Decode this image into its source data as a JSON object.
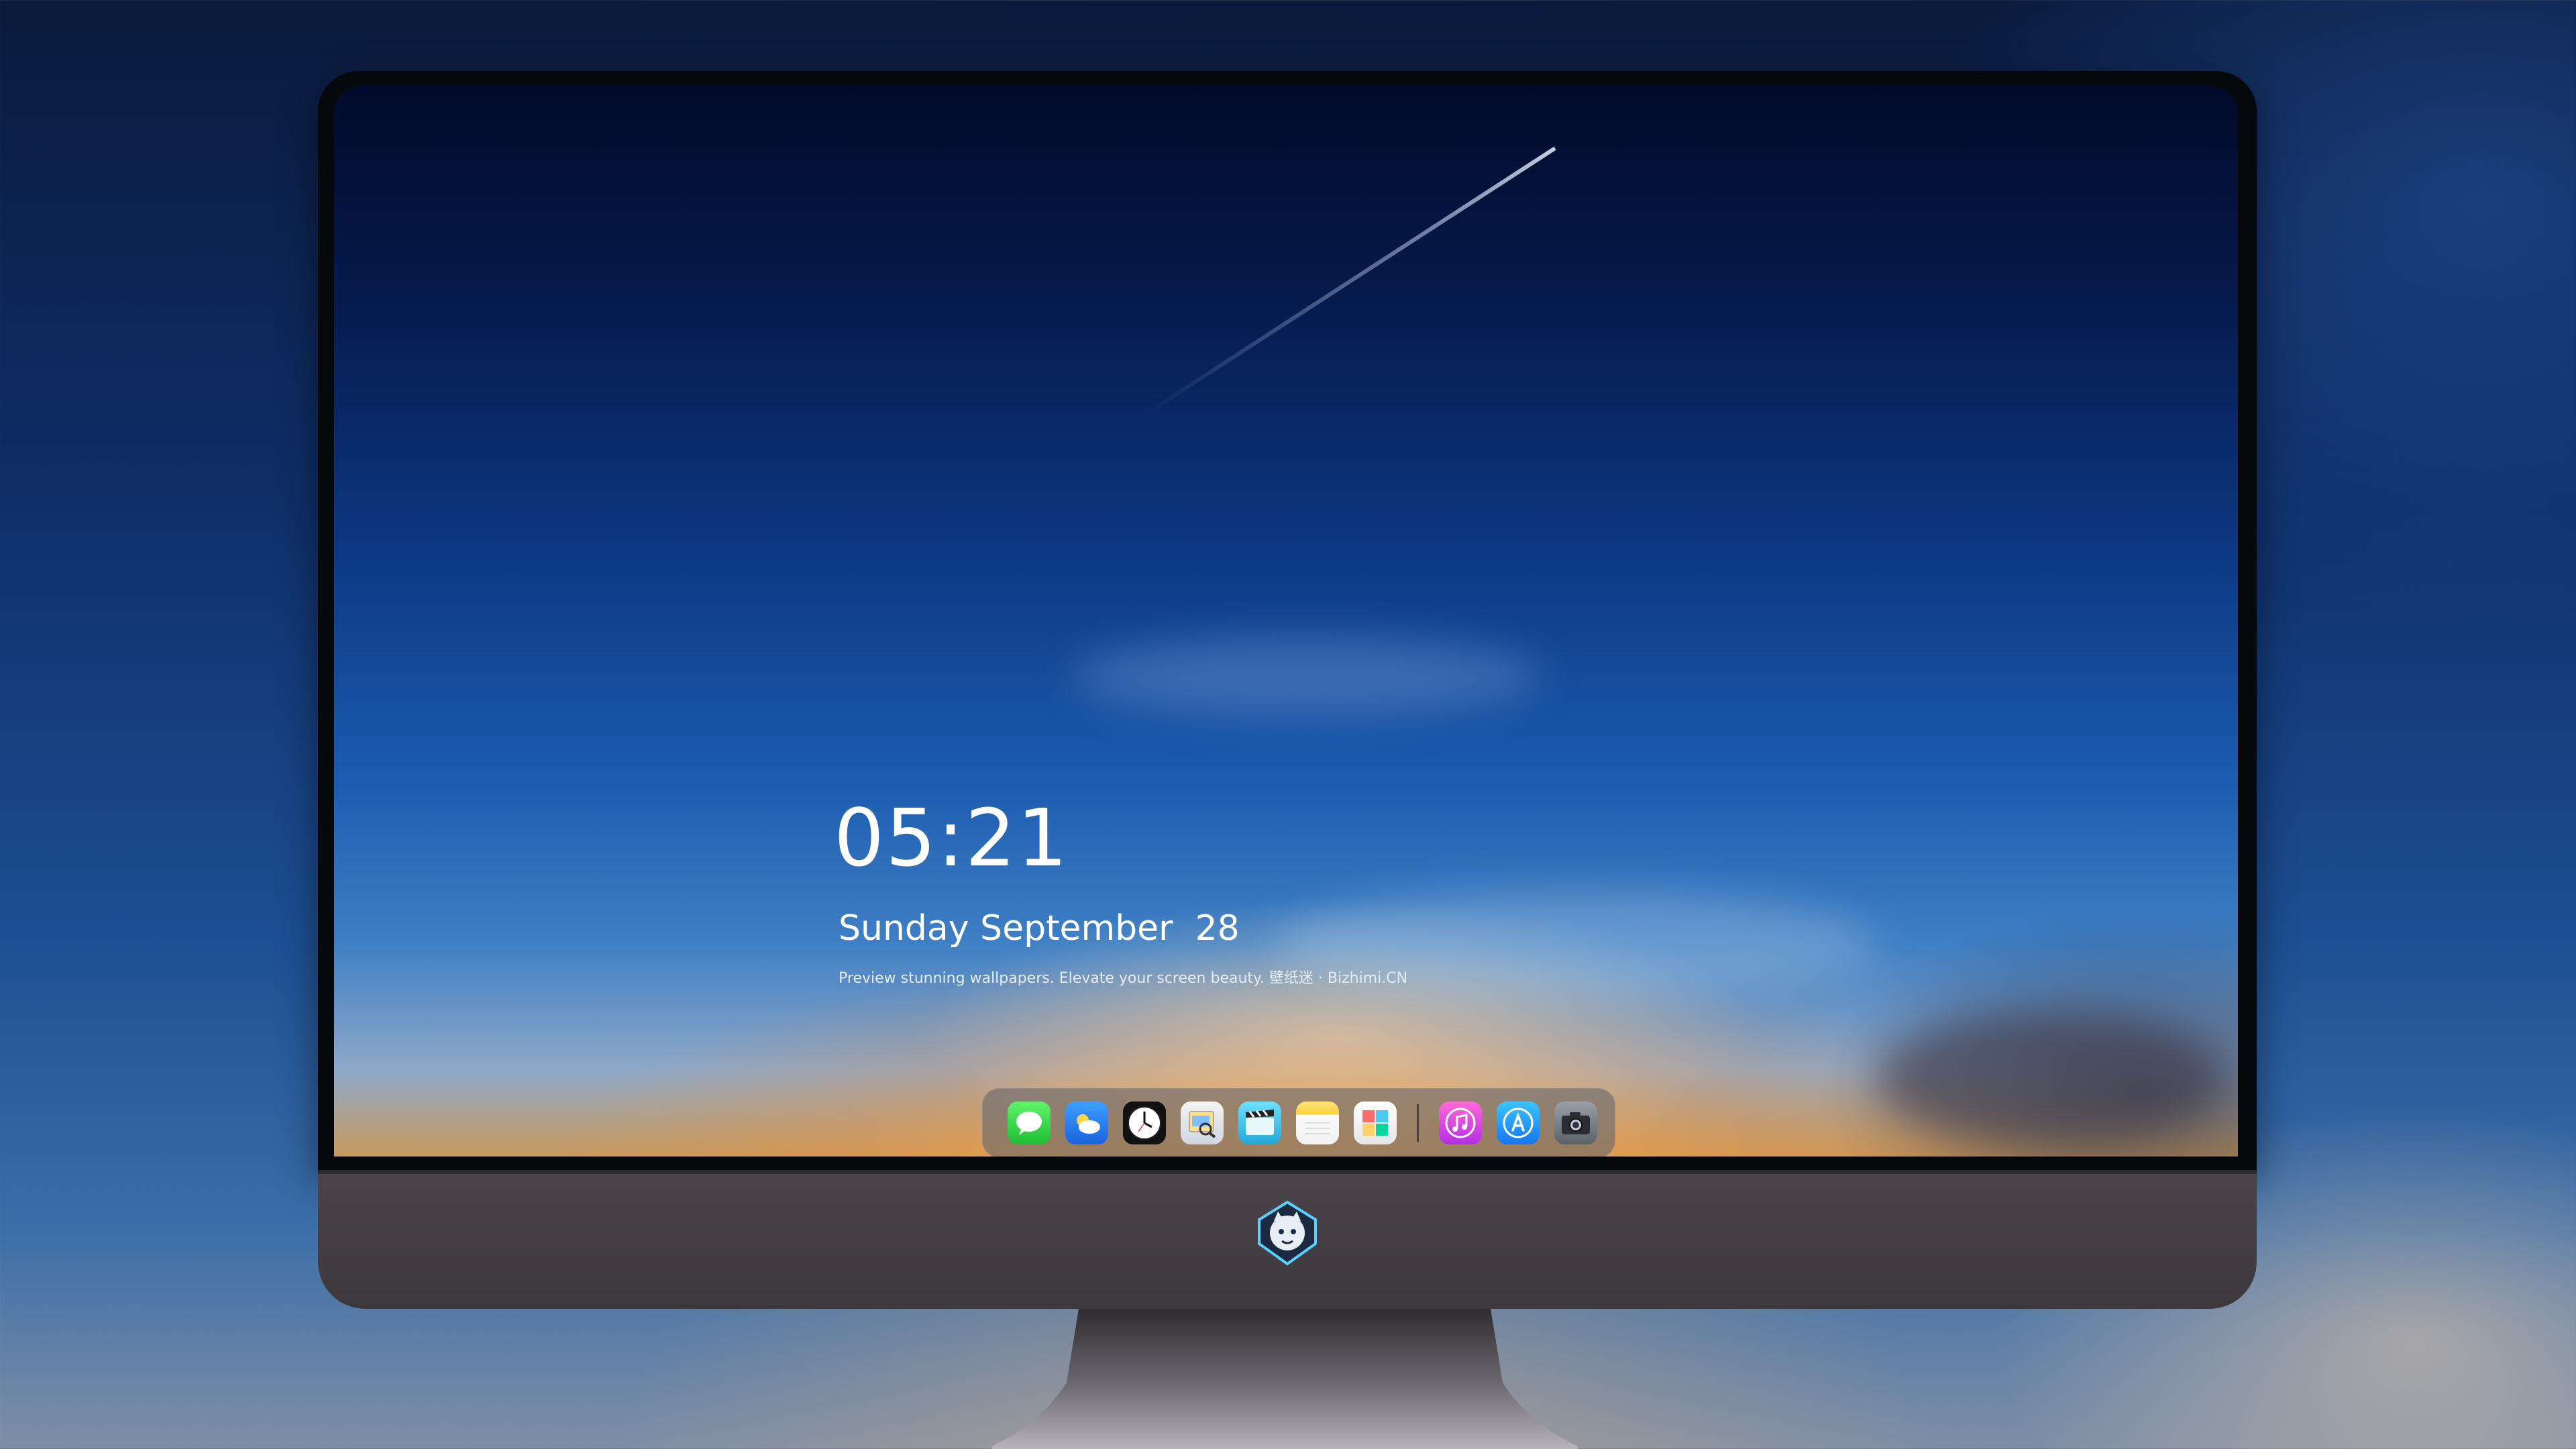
{
  "lockscreen": {
    "time": "05:21",
    "date": "Sunday September  28",
    "tagline": "Preview stunning wallpapers. Elevate your screen beauty. 壁纸迷 · Bizhimi.CN"
  },
  "dock": {
    "apps": [
      {
        "name": "Messages",
        "icon": "messages-icon"
      },
      {
        "name": "Weather",
        "icon": "weather-icon"
      },
      {
        "name": "Clock",
        "icon": "clock-icon"
      },
      {
        "name": "Preview",
        "icon": "preview-icon"
      },
      {
        "name": "Video",
        "icon": "clapperboard-icon"
      },
      {
        "name": "Notes",
        "icon": "notes-icon"
      },
      {
        "name": "Photos",
        "icon": "photos-icon"
      },
      {
        "name": "Music",
        "icon": "music-icon"
      },
      {
        "name": "App Store",
        "icon": "app-store-icon"
      },
      {
        "name": "Camera",
        "icon": "camera-icon"
      }
    ]
  },
  "monitor": {
    "logo": "mascot-logo-icon"
  },
  "colors": {
    "sky_top": "#020a2a",
    "sky_mid": "#1c5cb0",
    "horizon_glow": "#ffaa46",
    "bezel": "#07080c",
    "chin": "#4a4448"
  }
}
